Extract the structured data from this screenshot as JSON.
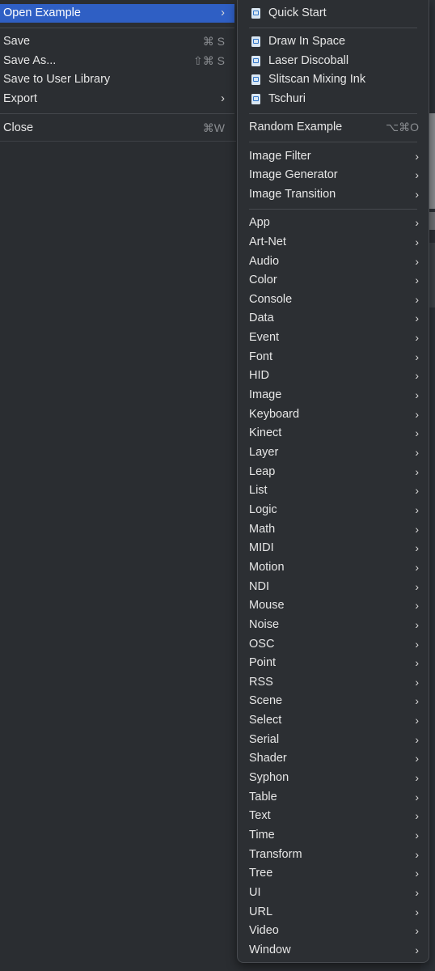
{
  "file_menu": {
    "open_example": "Open Example",
    "save": "Save",
    "save_shortcut": "⌘ S",
    "save_as": "Save As...",
    "save_as_shortcut": "⇧⌘ S",
    "save_to_library": "Save to User Library",
    "export": "Export",
    "close": "Close",
    "close_shortcut": "⌘W",
    "chevron": "›"
  },
  "examples_menu": {
    "quick_start": "Quick Start",
    "examples": [
      "Draw In Space",
      "Laser Discoball",
      "Slitscan Mixing Ink",
      "Tschuri"
    ],
    "random_example": "Random Example",
    "random_shortcut": "⌥⌘O",
    "image_groups": [
      "Image Filter",
      "Image Generator",
      "Image Transition"
    ],
    "categories": [
      "App",
      "Art-Net",
      "Audio",
      "Color",
      "Console",
      "Data",
      "Event",
      "Font",
      "HID",
      "Image",
      "Keyboard",
      "Kinect",
      "Layer",
      "Leap",
      "List",
      "Logic",
      "Math",
      "MIDI",
      "Motion",
      "NDI",
      "Mouse",
      "Noise",
      "OSC",
      "Point",
      "RSS",
      "Scene",
      "Select",
      "Serial",
      "Shader",
      "Syphon",
      "Table",
      "Text",
      "Time",
      "Transform",
      "Tree",
      "UI",
      "URL",
      "Video",
      "Window"
    ]
  },
  "colors": {
    "menu_bg": "#2b2e32",
    "highlight": "#2f5fc4",
    "text": "#e6e6e6",
    "shortcut": "#8a8d91",
    "icon_accent": "#2f74c7"
  }
}
